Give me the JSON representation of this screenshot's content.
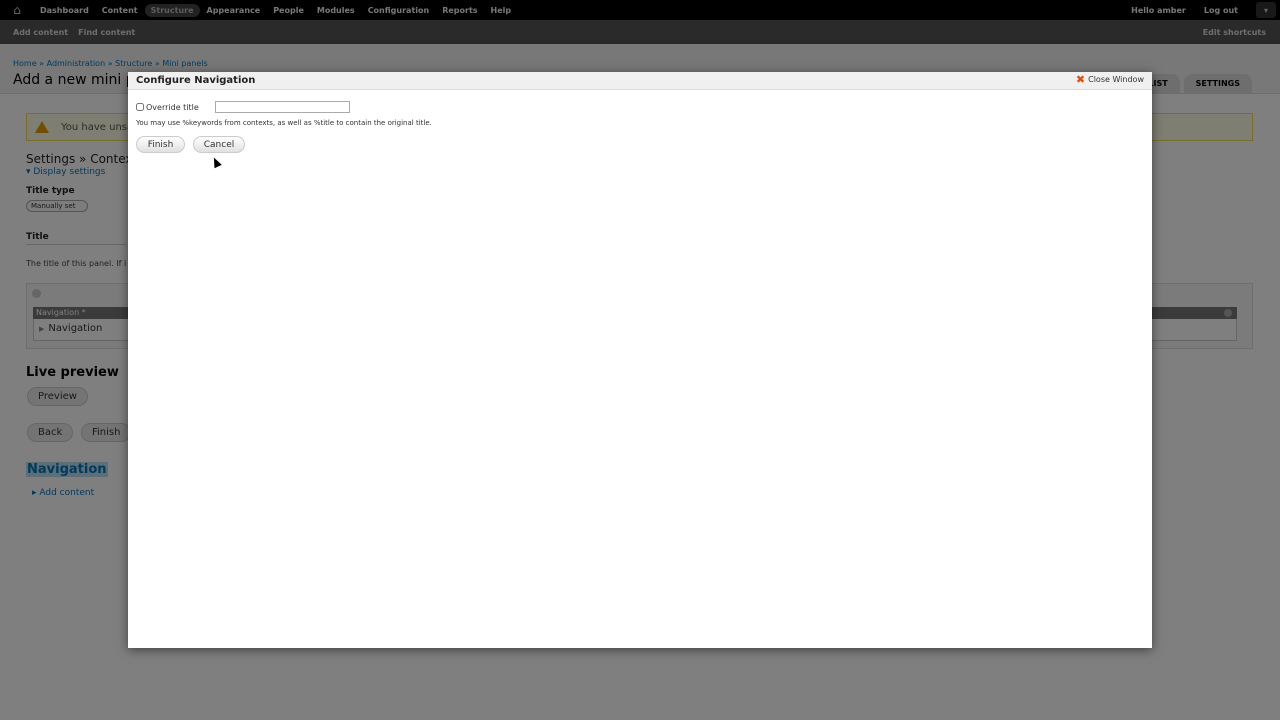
{
  "toolbar": {
    "menu": [
      "Dashboard",
      "Content",
      "Structure",
      "Appearance",
      "People",
      "Modules",
      "Configuration",
      "Reports",
      "Help"
    ],
    "active": "Structure",
    "user_greeting": "Hello amber",
    "logout": "Log out"
  },
  "shortcuts": {
    "add_content": "Add content",
    "find_content": "Find content",
    "edit_shortcuts": "Edit shortcuts"
  },
  "page": {
    "breadcrumb": "Home » Administration » Structure » Mini panels",
    "title": "Add a new mini pan",
    "tabs": [
      "LIST",
      "SETTINGS"
    ],
    "warning": "You have unsav",
    "section_title": "Settings » Context",
    "display_settings": "▾ Display settings",
    "title_type_label": "Title type",
    "title_type_value": "Manually set",
    "title_label": "Title",
    "title_desc": "The title of this panel. If i",
    "pane_bar": "Navigation *",
    "pane_body": "Navigation",
    "live_preview": "Live preview",
    "preview_btn": "Preview",
    "back_btn": "Back",
    "finish_btn": "Finish",
    "nav_heading": "Navigation",
    "add_content": "Add content"
  },
  "modal": {
    "title": "Configure Navigation",
    "close": "Close Window",
    "override_label": "Override title",
    "override_value": "",
    "help": "You may use %keywords from contexts, as well as %title to contain the original title.",
    "finish": "Finish",
    "cancel": "Cancel"
  }
}
